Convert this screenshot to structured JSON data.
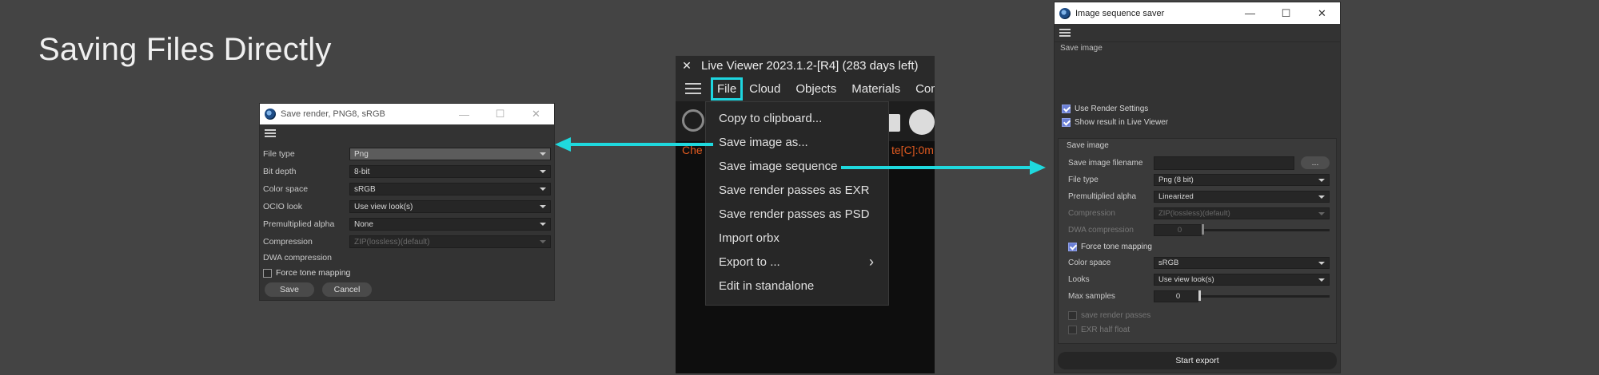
{
  "slide": {
    "title": "Saving Files Directly"
  },
  "colors": {
    "accent_cyan": "#1fd9de",
    "checkbox_blue": "#6a7fd6",
    "error_orange": "#e05a20"
  },
  "save_render_dialog": {
    "title": "Save render, PNG8, sRGB",
    "controls": {
      "minimize": "—",
      "maximize": "☐",
      "close": "✕"
    },
    "fields": [
      {
        "label": "File type",
        "value": "Png"
      },
      {
        "label": "Bit depth",
        "value": "8-bit"
      },
      {
        "label": "Color space",
        "value": "sRGB"
      },
      {
        "label": "OCIO look",
        "value": "Use view look(s)"
      },
      {
        "label": "Premultiplied alpha",
        "value": "None"
      },
      {
        "label": "Compression",
        "value": "ZIP(lossless)(default)"
      }
    ],
    "dwa_label": "DWA compression",
    "force_tone_mapping": {
      "label": "Force tone mapping",
      "checked": false
    },
    "save_label": "Save",
    "cancel_label": "Cancel"
  },
  "live_viewer": {
    "close_glyph": "✕",
    "title": "Live Viewer 2023.1.2-[R4] (283 days left)",
    "menu": [
      "File",
      "Cloud",
      "Objects",
      "Materials",
      "Com"
    ],
    "status_left": "Che",
    "status_right": "te[C]:0m",
    "file_menu": [
      "Copy to clipboard...",
      "Save image as...",
      "Save image sequence",
      "Save render passes as EXR",
      "Save render passes as PSD",
      "Import orbx",
      "Export to ...",
      "Edit in standalone"
    ],
    "submenu_glyph": "›"
  },
  "sequence_dialog": {
    "title": "Image sequence saver",
    "controls": {
      "minimize": "—",
      "maximize": "☐",
      "close": "✕"
    },
    "save_image_header": "Save image",
    "use_render_settings": {
      "label": "Use Render Settings",
      "checked": true
    },
    "show_result": {
      "label": "Show result in Live Viewer",
      "checked": true
    },
    "group_title": "Save image",
    "filename_label": "Save image filename",
    "filename_value": "",
    "browse_label": "...",
    "file_type": {
      "label": "File type",
      "value": "Png (8 bit)"
    },
    "premultiplied_alpha": {
      "label": "Premultiplied alpha",
      "value": "Linearized"
    },
    "compression": {
      "label": "Compression",
      "value": "ZIP(lossless)(default)"
    },
    "dwa_compression": {
      "label": "DWA compression",
      "value": "0"
    },
    "force_tone_mapping": {
      "label": "Force tone mapping",
      "checked": true
    },
    "color_space": {
      "label": "Color space",
      "value": "sRGB"
    },
    "looks": {
      "label": "Looks",
      "value": "Use view look(s)"
    },
    "max_samples": {
      "label": "Max samples",
      "value": "0"
    },
    "save_render_passes": {
      "label": "save render passes",
      "checked": false
    },
    "exr_half_float": {
      "label": "EXR half float",
      "checked": false
    },
    "start_export_label": "Start export"
  }
}
